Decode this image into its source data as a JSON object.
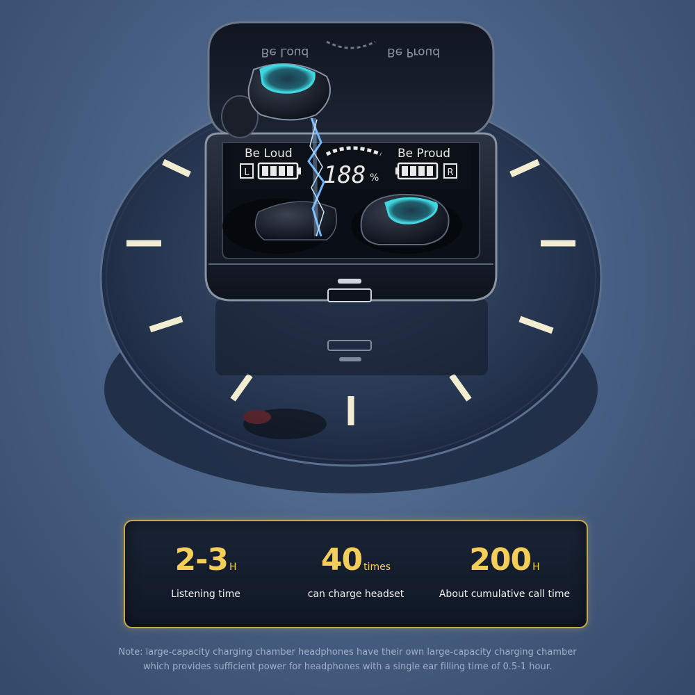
{
  "product": {
    "lcd": {
      "left_text": "Be  Loud",
      "right_text": "Be Proud",
      "left_channel": "L",
      "right_channel": "R",
      "digits": "188",
      "percent_sign": "%"
    },
    "lid_mirror_left": "Be Loud",
    "lid_mirror_right": "Be Proud"
  },
  "stats": [
    {
      "value": "2-3",
      "unit": "H",
      "caption": "Listening time"
    },
    {
      "value": "40",
      "unit": "times",
      "caption": "can charge headset"
    },
    {
      "value": "200",
      "unit": "H",
      "caption": "About cumulative call time"
    }
  ],
  "note": {
    "line1": "Note: large-capacity charging chamber headphones have their own large-capacity charging chamber",
    "line2": "which provides sufficient power for headphones with a single ear filling time of 0.5-1 hour."
  },
  "colors": {
    "accent_gold": "#f3cf5a",
    "lcd_text": "#e8e8e8",
    "earbud_glow": "#3fd6df",
    "lightning": "#6fb8ff"
  }
}
